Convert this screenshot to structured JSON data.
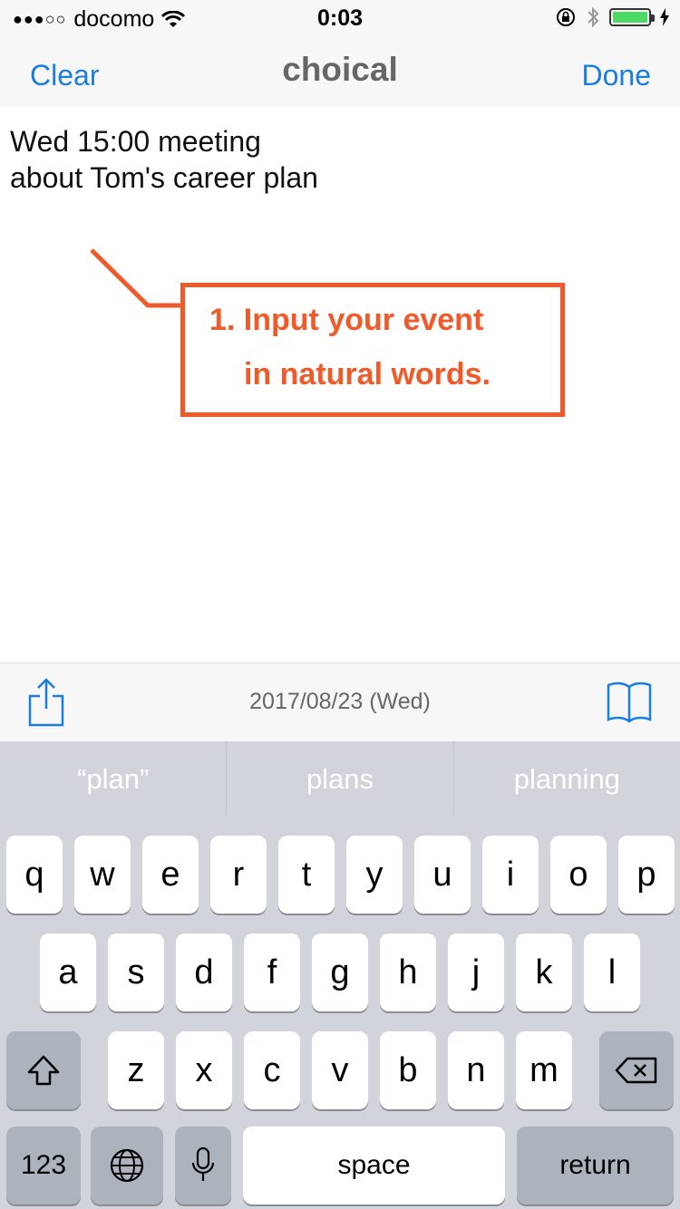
{
  "status_bar": {
    "signal": "●●●○○",
    "carrier": "docomo",
    "time": "0:03"
  },
  "nav": {
    "left_label": "Clear",
    "title": "choical",
    "right_label": "Done"
  },
  "editor": {
    "line1": "Wed 15:00 meeting",
    "line2": "about Tom's career plan"
  },
  "callout": {
    "line1": "1. Input your event",
    "line2": "in natural words.",
    "color": "#ef5a2a"
  },
  "toolbar": {
    "date": "2017/08/23 (Wed)",
    "share_icon": "share-icon",
    "book_icon": "book-icon"
  },
  "keyboard": {
    "suggestions": [
      "“plan”",
      "plans",
      "planning"
    ],
    "row1": [
      "q",
      "w",
      "e",
      "r",
      "t",
      "y",
      "u",
      "i",
      "o",
      "p"
    ],
    "row2": [
      "a",
      "s",
      "d",
      "f",
      "g",
      "h",
      "j",
      "k",
      "l"
    ],
    "row3": [
      "z",
      "x",
      "c",
      "v",
      "b",
      "n",
      "m"
    ],
    "numbers_label": "123",
    "space_label": "space",
    "return_label": "return"
  },
  "colors": {
    "accent": "#1a7de0",
    "keyboard_bg": "#d1d5db",
    "battery": "#4cd964"
  }
}
